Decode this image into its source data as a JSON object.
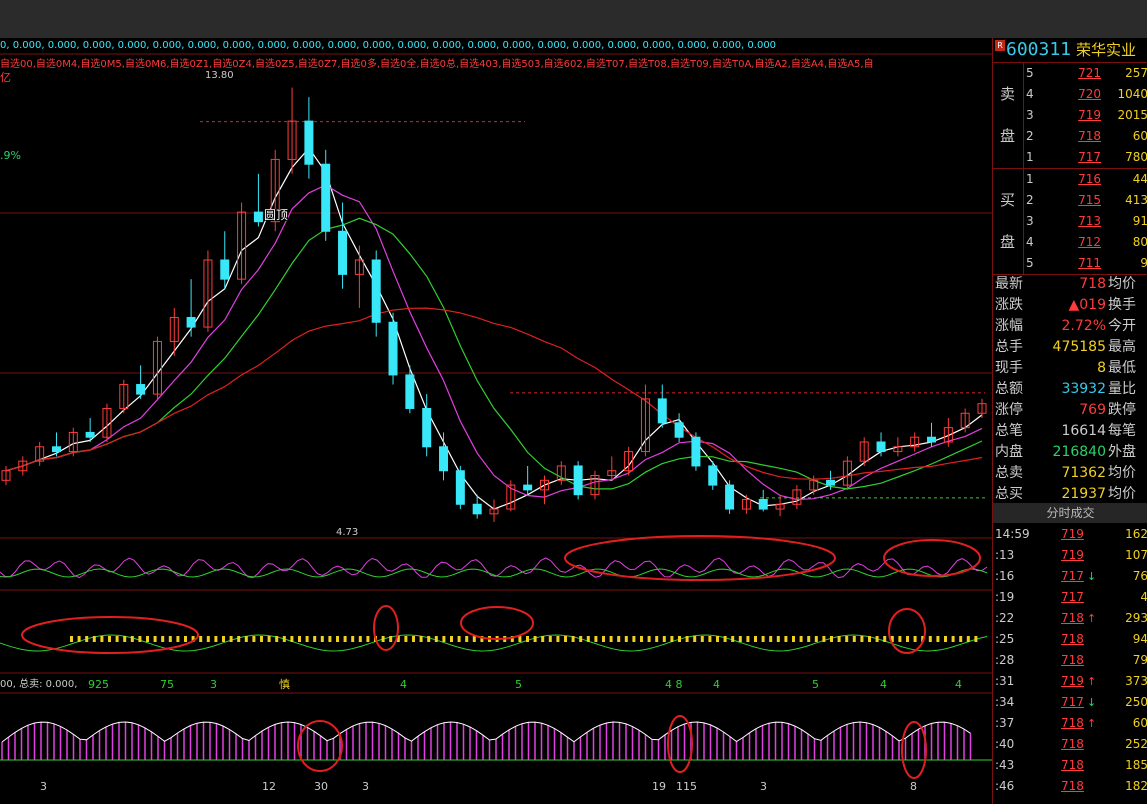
{
  "indicator_values": "0, 0.000, 0.000, 0.000, 0.000, 0.000, 0.000, 0.000, 0.000, 0.000, 0.000, 0.000, 0.000, 0.000, 0.000, 0.000, 0.000, 0.000, 0.000, 0.000, 0.000, 0.000, 0.000",
  "watchlists": "自选00,自选0M4,自选0M5,自选0M6,自选0Z1,自选0Z4,自选0Z5,自选0Z7,自选0多,自选0全,自选0总,自选403,自选503,自选602,自选T07,自选T08,自选T09,自选T0A,自选A2,自选A4,自选A5,自",
  "yi_char": "亿",
  "pct_label": ".9%",
  "price_high_label": "13.80",
  "price_low_label": "4.73",
  "pattern_label": "圆顶",
  "buy_sell_label": "00, 总卖: 0.000,",
  "lower_labels": [
    "925",
    "75",
    "3",
    "慎",
    "4",
    "5",
    "4 8",
    "4",
    "5",
    "4",
    "4"
  ],
  "bottom_labels": [
    "3",
    "12",
    "30",
    "3",
    "19",
    "115",
    "3",
    "8"
  ],
  "stock": {
    "badge": "R",
    "code": "600311",
    "name": "荣华实业"
  },
  "order_book": {
    "sell_side": "卖",
    "sell_side2": "盘",
    "buy_side": "买",
    "buy_side2": "盘",
    "sells": [
      {
        "level": "5",
        "price": "721",
        "vol": "257"
      },
      {
        "level": "4",
        "price": "720",
        "vol": "1040"
      },
      {
        "level": "3",
        "price": "719",
        "vol": "2015"
      },
      {
        "level": "2",
        "price": "718",
        "vol": "60"
      },
      {
        "level": "1",
        "price": "717",
        "vol": "780"
      }
    ],
    "buys": [
      {
        "level": "1",
        "price": "716",
        "vol": "44"
      },
      {
        "level": "2",
        "price": "715",
        "vol": "413"
      },
      {
        "level": "3",
        "price": "713",
        "vol": "91"
      },
      {
        "level": "4",
        "price": "712",
        "vol": "80"
      },
      {
        "level": "5",
        "price": "711",
        "vol": "9"
      }
    ]
  },
  "quote": [
    {
      "label": "最新",
      "value": "718",
      "label2": "均价",
      "color": "#ff3b3b"
    },
    {
      "label": "涨跌",
      "value": "▲019",
      "label2": "换手",
      "color": "#ff3b3b"
    },
    {
      "label": "涨幅",
      "value": "2.72%",
      "label2": "今开",
      "color": "#ff3b3b"
    },
    {
      "label": "总手",
      "value": "475185",
      "label2": "最高",
      "color": "#f0d020"
    },
    {
      "label": "现手",
      "value": "8",
      "label2": "最低",
      "color": "#f0d020"
    },
    {
      "label": "总额",
      "value": "33932",
      "label2": "量比",
      "color": "#38c8e8"
    },
    {
      "label": "涨停",
      "value": "769",
      "label2": "跌停",
      "color": "#ff3b3b"
    },
    {
      "label": "总笔",
      "value": "16614",
      "label2": "每笔",
      "color": "#cccccc"
    },
    {
      "label": "内盘",
      "value": "216840",
      "label2": "外盘",
      "color": "#2ad26a"
    },
    {
      "label": "总卖",
      "value": "71362",
      "label2": "均价",
      "color": "#f0d020"
    },
    {
      "label": "总买",
      "value": "21937",
      "label2": "均价",
      "color": "#f0d020"
    }
  ],
  "trades_header": "分时成交",
  "trades": [
    {
      "time": "14:59",
      "price": "719",
      "arrow": "",
      "vol": "162"
    },
    {
      "time": ":13",
      "price": "719",
      "arrow": "",
      "vol": "107"
    },
    {
      "time": ":16",
      "price": "717",
      "arrow": "↓",
      "vol": "76"
    },
    {
      "time": ":19",
      "price": "717",
      "arrow": "",
      "vol": "4"
    },
    {
      "time": ":22",
      "price": "718",
      "arrow": "↑",
      "vol": "293"
    },
    {
      "time": ":25",
      "price": "718",
      "arrow": "",
      "vol": "94"
    },
    {
      "time": ":28",
      "price": "718",
      "arrow": "",
      "vol": "79"
    },
    {
      "time": ":31",
      "price": "719",
      "arrow": "↑",
      "vol": "373"
    },
    {
      "time": ":34",
      "price": "717",
      "arrow": "↓",
      "vol": "250"
    },
    {
      "time": ":37",
      "price": "718",
      "arrow": "↑",
      "vol": "60"
    },
    {
      "time": ":40",
      "price": "718",
      "arrow": "",
      "vol": "252"
    },
    {
      "time": ":43",
      "price": "718",
      "arrow": "",
      "vol": "185"
    },
    {
      "time": ":46",
      "price": "718",
      "arrow": "",
      "vol": "182"
    }
  ],
  "colors": {
    "up": "#ff3b3b",
    "down": "#38e8f8",
    "ma5": "#ffffff",
    "ma10": "#e040e0",
    "ma20": "#30d030",
    "ma60": "#e02020",
    "border": "#7a1010"
  },
  "candles": [
    [
      5.6,
      5.9,
      5.5,
      5.8
    ],
    [
      5.8,
      6.1,
      5.7,
      6.0
    ],
    [
      6.0,
      6.4,
      5.9,
      6.3
    ],
    [
      6.3,
      6.6,
      6.1,
      6.2
    ],
    [
      6.2,
      6.7,
      6.1,
      6.6
    ],
    [
      6.6,
      6.9,
      6.4,
      6.5
    ],
    [
      6.5,
      7.2,
      6.4,
      7.1
    ],
    [
      7.1,
      7.7,
      7.0,
      7.6
    ],
    [
      7.6,
      8.0,
      7.3,
      7.4
    ],
    [
      7.4,
      8.6,
      7.3,
      8.5
    ],
    [
      8.5,
      9.2,
      8.2,
      9.0
    ],
    [
      9.0,
      9.8,
      8.6,
      8.8
    ],
    [
      8.8,
      10.4,
      8.7,
      10.2
    ],
    [
      10.2,
      10.8,
      9.6,
      9.8
    ],
    [
      9.8,
      11.4,
      9.7,
      11.2
    ],
    [
      11.2,
      12.0,
      10.9,
      11.0
    ],
    [
      11.0,
      12.5,
      10.8,
      12.3
    ],
    [
      12.3,
      13.8,
      12.0,
      13.1
    ],
    [
      13.1,
      13.6,
      11.9,
      12.2
    ],
    [
      12.2,
      12.5,
      10.6,
      10.8
    ],
    [
      10.8,
      11.4,
      9.6,
      9.9
    ],
    [
      9.9,
      10.5,
      9.2,
      10.2
    ],
    [
      10.2,
      10.4,
      8.6,
      8.9
    ],
    [
      8.9,
      9.1,
      7.6,
      7.8
    ],
    [
      7.8,
      8.0,
      7.0,
      7.1
    ],
    [
      7.1,
      7.4,
      6.1,
      6.3
    ],
    [
      6.3,
      6.6,
      5.6,
      5.8
    ],
    [
      5.8,
      5.9,
      5.0,
      5.1
    ],
    [
      5.1,
      5.3,
      4.8,
      4.9
    ],
    [
      4.9,
      5.2,
      4.73,
      5.0
    ],
    [
      5.0,
      5.6,
      4.95,
      5.5
    ],
    [
      5.5,
      5.9,
      5.3,
      5.4
    ],
    [
      5.4,
      5.7,
      5.1,
      5.6
    ],
    [
      5.6,
      6.0,
      5.5,
      5.9
    ],
    [
      5.9,
      6.0,
      5.2,
      5.3
    ],
    [
      5.3,
      5.8,
      5.2,
      5.7
    ],
    [
      5.7,
      6.1,
      5.6,
      5.8
    ],
    [
      5.8,
      6.3,
      5.7,
      6.2
    ],
    [
      6.2,
      7.6,
      6.1,
      7.3
    ],
    [
      7.3,
      7.6,
      6.7,
      6.8
    ],
    [
      6.8,
      7.0,
      6.4,
      6.5
    ],
    [
      6.5,
      6.6,
      5.8,
      5.9
    ],
    [
      5.9,
      6.0,
      5.4,
      5.5
    ],
    [
      5.5,
      5.6,
      4.9,
      5.0
    ],
    [
      5.0,
      5.3,
      4.9,
      5.2
    ],
    [
      5.2,
      5.4,
      4.95,
      5.0
    ],
    [
      5.0,
      5.3,
      4.85,
      5.1
    ],
    [
      5.1,
      5.5,
      5.0,
      5.4
    ],
    [
      5.4,
      5.7,
      5.3,
      5.6
    ],
    [
      5.6,
      5.8,
      5.4,
      5.5
    ],
    [
      5.5,
      6.1,
      5.4,
      6.0
    ],
    [
      6.0,
      6.5,
      5.9,
      6.4
    ],
    [
      6.4,
      6.6,
      6.1,
      6.2
    ],
    [
      6.2,
      6.5,
      6.1,
      6.3
    ],
    [
      6.3,
      6.6,
      6.2,
      6.5
    ],
    [
      6.5,
      6.8,
      6.3,
      6.4
    ],
    [
      6.4,
      6.9,
      6.3,
      6.7
    ],
    [
      6.7,
      7.1,
      6.6,
      7.0
    ],
    [
      7.0,
      7.3,
      6.9,
      7.2
    ]
  ]
}
